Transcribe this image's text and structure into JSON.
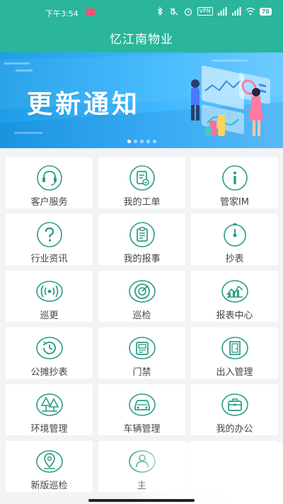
{
  "status": {
    "time": "下午3:54",
    "vpn": "VPN",
    "battery": "78"
  },
  "app": {
    "title": "忆江南物业"
  },
  "banner": {
    "title": "更新通知",
    "dots": 5,
    "active_dot": 0
  },
  "colors": {
    "brand": "#2bb59a",
    "banner_blue": "#2aa8f2",
    "icon": "#2a9c84"
  },
  "tiles": [
    {
      "label": "客户服务",
      "icon": "headset-icon"
    },
    {
      "label": "我的工单",
      "icon": "work-order-icon"
    },
    {
      "label": "管家IM",
      "icon": "info-icon"
    },
    {
      "label": "行业资讯",
      "icon": "question-icon"
    },
    {
      "label": "我的报事",
      "icon": "report-icon"
    },
    {
      "label": "抄表",
      "icon": "meter-icon"
    },
    {
      "label": "巡更",
      "icon": "signal-icon"
    },
    {
      "label": "巡检",
      "icon": "radar-icon"
    },
    {
      "label": "报表中心",
      "icon": "chart-icon"
    },
    {
      "label": "公摊抄表",
      "icon": "history-icon"
    },
    {
      "label": "门禁",
      "icon": "access-card-icon"
    },
    {
      "label": "出入管理",
      "icon": "door-icon"
    },
    {
      "label": "环境管理",
      "icon": "trees-icon"
    },
    {
      "label": "车辆管理",
      "icon": "car-icon"
    },
    {
      "label": "我的办公",
      "icon": "briefcase-icon"
    },
    {
      "label": "新版巡检",
      "icon": "location-icon"
    },
    {
      "label": "主",
      "icon": "user-icon"
    },
    {
      "label": "",
      "icon": ""
    }
  ]
}
